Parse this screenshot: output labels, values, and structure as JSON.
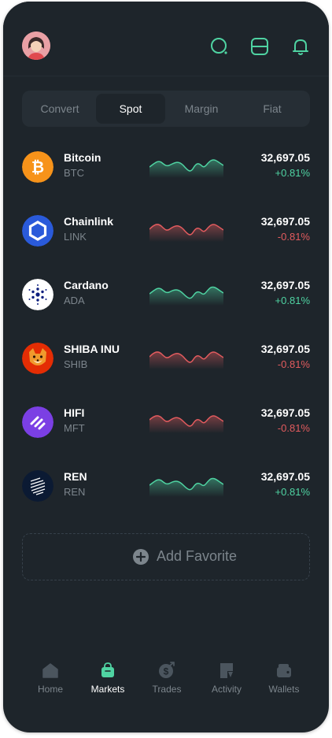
{
  "segments": [
    "Convert",
    "Spot",
    "Margin",
    "Fiat"
  ],
  "active_segment": "Spot",
  "coins": [
    {
      "name": "Bitcoin",
      "symbol": "BTC",
      "price": "32,697.05",
      "change": "+0.81%",
      "trend": "up",
      "icon": "bitcoin-icon"
    },
    {
      "name": "Chainlink",
      "symbol": "LINK",
      "price": "32,697.05",
      "change": "-0.81%",
      "trend": "down",
      "icon": "chainlink-icon"
    },
    {
      "name": "Cardano",
      "symbol": "ADA",
      "price": "32,697.05",
      "change": "+0.81%",
      "trend": "up",
      "icon": "cardano-icon"
    },
    {
      "name": "SHIBA INU",
      "symbol": "SHIB",
      "price": "32,697.05",
      "change": "-0.81%",
      "trend": "down",
      "icon": "shiba-inu-icon"
    },
    {
      "name": "HIFI",
      "symbol": "MFT",
      "price": "32,697.05",
      "change": "-0.81%",
      "trend": "down",
      "icon": "hifi-icon"
    },
    {
      "name": "REN",
      "symbol": "REN",
      "price": "32,697.05",
      "change": "+0.81%",
      "trend": "up",
      "icon": "ren-icon"
    }
  ],
  "add_favorite_label": "Add Favorite",
  "nav": [
    {
      "label": "Home",
      "icon": "home-icon",
      "active": false
    },
    {
      "label": "Markets",
      "icon": "markets-bag-icon",
      "active": true
    },
    {
      "label": "Trades",
      "icon": "trades-icon",
      "active": false
    },
    {
      "label": "Activity",
      "icon": "activity-icon",
      "active": false
    },
    {
      "label": "Wallets",
      "icon": "wallets-icon",
      "active": false
    }
  ],
  "colors": {
    "background": "#1e252b",
    "accent_up": "#4fd3a2",
    "accent_down": "#e25b5e",
    "muted": "#7c858c"
  }
}
